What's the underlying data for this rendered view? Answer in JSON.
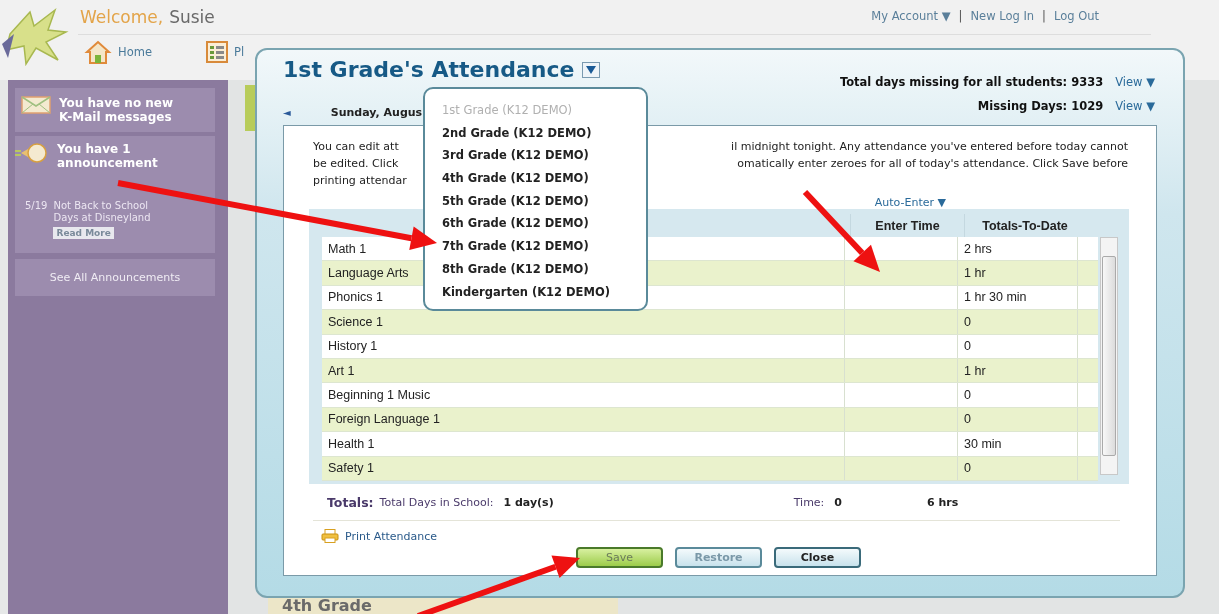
{
  "header": {
    "welcome": "Welcome,",
    "user": "Susie",
    "account_links": [
      {
        "kind": "link",
        "text": "My Account ▼"
      },
      {
        "kind": "separator",
        "text": "|"
      },
      {
        "kind": "link",
        "text": "New Log In"
      },
      {
        "kind": "separator",
        "text": "|"
      },
      {
        "kind": "link",
        "text": "Log Out"
      }
    ],
    "nav": [
      {
        "label": "Home"
      },
      {
        "label": "Pl"
      }
    ]
  },
  "sidebar": {
    "messages": "You have no new K-Mail messages",
    "announcements": "You have 1 announcement",
    "items": [
      {
        "date": "5/19",
        "title": "Not Back to School Days at Disneyland",
        "link": "Read More"
      }
    ],
    "see_all": "See All Announcements"
  },
  "background": {
    "card_title": "4th Grade"
  },
  "modal": {
    "title": "1st Grade's Attendance",
    "stats": [
      {
        "label": "Total days missing for all students: 9333",
        "link": "View ▼"
      },
      {
        "label": "Missing Days: 1029",
        "link": "View ▼"
      }
    ],
    "date_nav": {
      "prev": "◄",
      "date": "Sunday, Augus"
    },
    "notice_lines": [
      {
        "left": "You can edit att",
        "right": "il midnight tonight. Any attendance you've entered before today cannot"
      },
      {
        "left": "be edited. Click",
        "right": "omatically enter zeroes for all of today's attendance. Click Save before"
      },
      {
        "left": "printing attendar"
      }
    ],
    "auto_enter": "Auto-Enter ▼",
    "table": {
      "columns": [
        "Enter Time",
        "Totals-To-Date"
      ],
      "rows": [
        {
          "course": "Math 1",
          "total": "2 hrs"
        },
        {
          "course": "Language Arts",
          "total": "1 hr"
        },
        {
          "course": "Phonics 1",
          "total": "1 hr 30 min"
        },
        {
          "course": "Science 1",
          "total": "0"
        },
        {
          "course": "History 1",
          "total": "0"
        },
        {
          "course": "Art 1",
          "total": "1 hr"
        },
        {
          "course": "Beginning 1 Music",
          "total": "0"
        },
        {
          "course": "Foreign Language 1",
          "total": "0"
        },
        {
          "course": "Health 1",
          "total": "30 min"
        },
        {
          "course": "Safety 1",
          "total": "0"
        }
      ]
    },
    "totals": {
      "label": "Totals:",
      "days_label": "Total Days in School:",
      "days": "1 day(s)",
      "time_label": "Time:",
      "time": "0",
      "total": "6 hrs"
    },
    "print": "Print Attendance",
    "buttons": [
      {
        "label": "Save",
        "kind": "primary"
      },
      {
        "label": "Restore",
        "kind": "muted"
      },
      {
        "label": "Close",
        "kind": "default"
      }
    ]
  },
  "grade_menu": {
    "items": [
      {
        "label": "1st Grade (K12 DEMO)",
        "disabled": true
      },
      {
        "label": "2nd Grade (K12 DEMO)",
        "disabled": false
      },
      {
        "label": "3rd Grade (K12 DEMO)",
        "disabled": false
      },
      {
        "label": "4th Grade (K12 DEMO)",
        "disabled": false
      },
      {
        "label": "5th Grade (K12 DEMO)",
        "disabled": false
      },
      {
        "label": "6th Grade (K12 DEMO)",
        "disabled": false
      },
      {
        "label": "7th Grade (K12 DEMO)",
        "disabled": false
      },
      {
        "label": "8th Grade (K12 DEMO)",
        "disabled": false
      },
      {
        "label": "Kindergarten (K12 DEMO)",
        "disabled": false
      }
    ]
  }
}
